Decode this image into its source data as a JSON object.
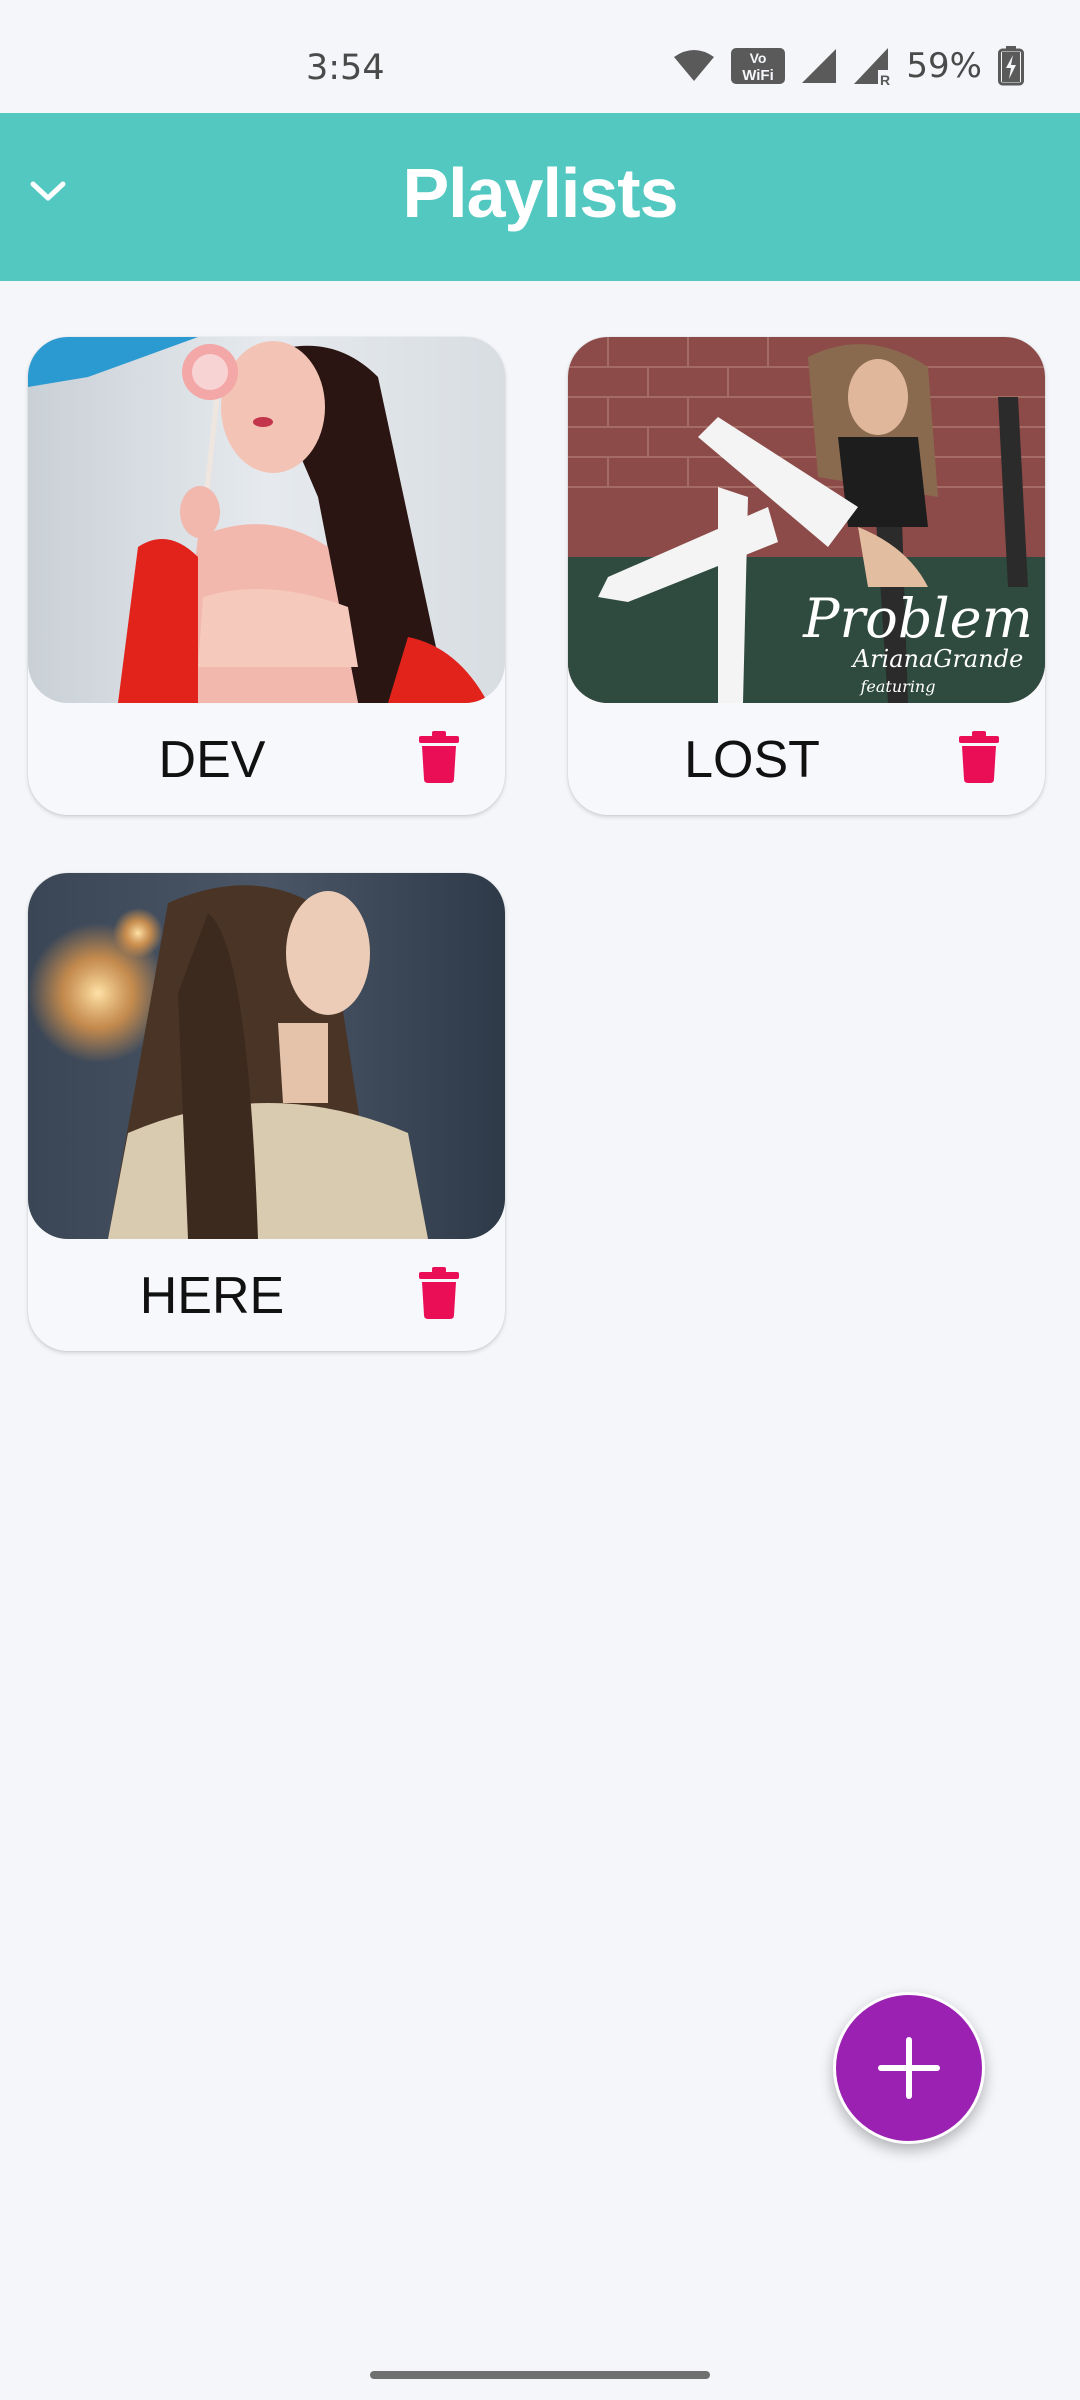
{
  "status_bar": {
    "time": "3:54",
    "battery_percent": "59%",
    "icons": [
      "wifi-icon",
      "vowifi-icon",
      "signal-icon",
      "signal-roaming-icon",
      "battery-charging-icon"
    ]
  },
  "toolbar": {
    "title": "Playlists",
    "back_icon": "chevron-down-icon",
    "background": "#52c8c1"
  },
  "playlists": [
    {
      "name": "DEV",
      "thumbnail": "woman-with-lollipop-red-jacket",
      "delete_icon": "trash-icon"
    },
    {
      "name": "LOST",
      "thumbnail": "problem-album-cover",
      "delete_icon": "trash-icon"
    },
    {
      "name": "HERE",
      "thumbnail": "woman-looking-up-long-hair",
      "delete_icon": "trash-icon"
    }
  ],
  "thumbnail_text": {
    "problem_title": "Problem",
    "problem_artist": "ArianaGrande",
    "problem_featuring": "featuring"
  },
  "fab": {
    "icon": "plus-icon",
    "color": "#9b21b3"
  },
  "colors": {
    "accent": "#52c8c1",
    "delete": "#ea0e57",
    "background": "#f4f6fa"
  }
}
